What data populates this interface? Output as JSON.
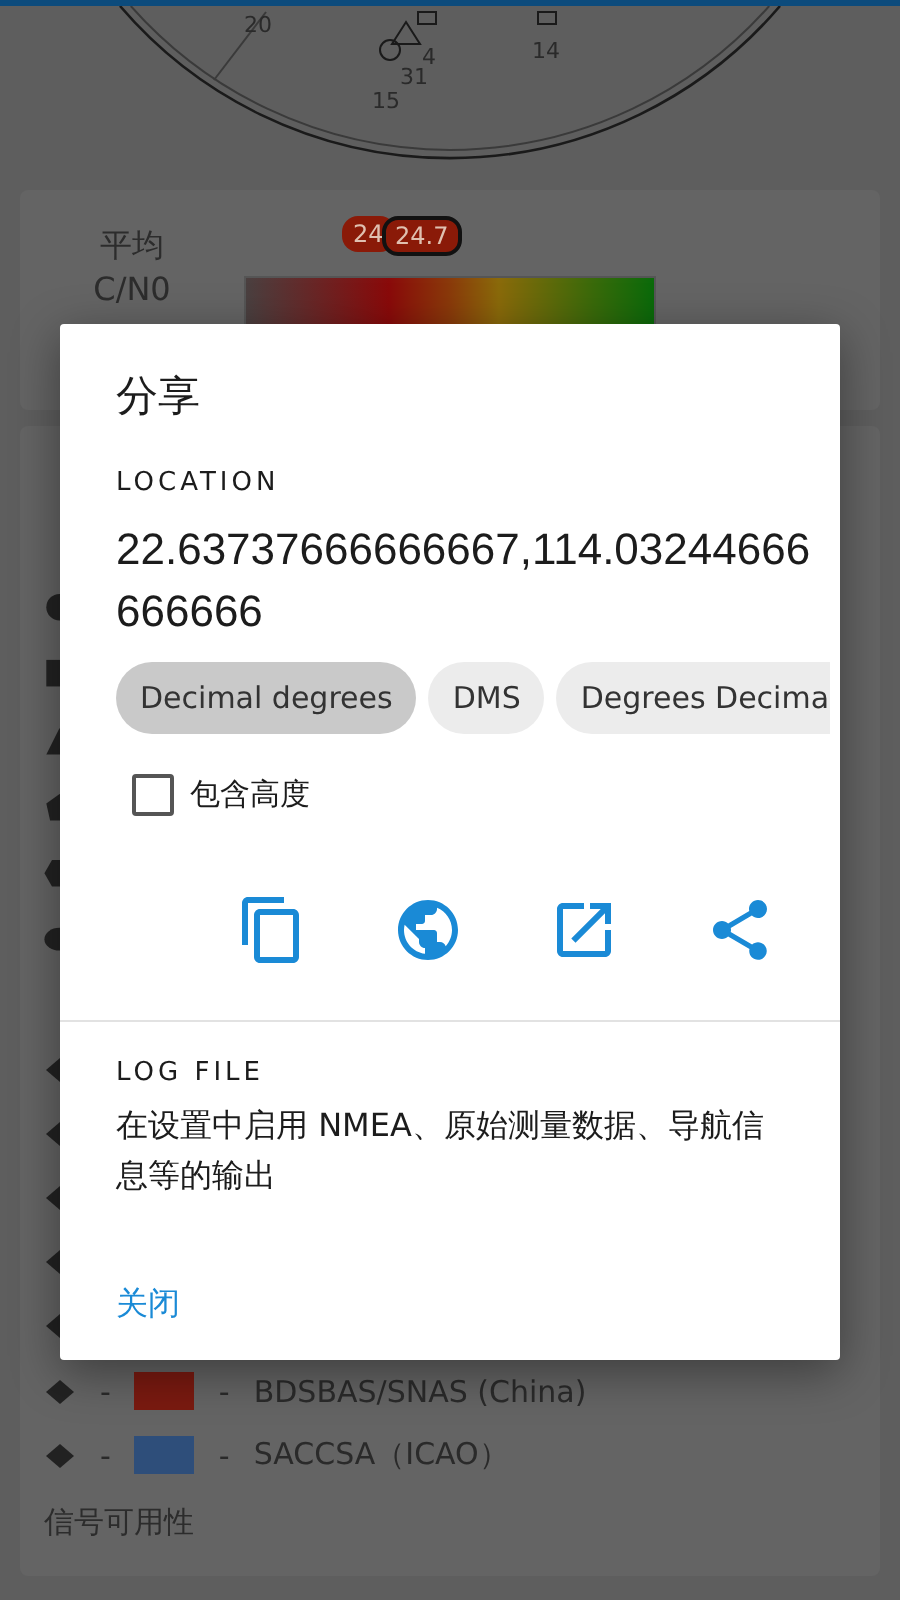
{
  "sky_plot": {
    "labels": [
      "20",
      "4",
      "31",
      "15",
      "14"
    ]
  },
  "cn0_card": {
    "title_lines": [
      "平均",
      "C/N0"
    ],
    "level": 0.42,
    "badges": [
      {
        "text": "24",
        "selected": false
      },
      {
        "text": "24.7",
        "selected": true
      }
    ]
  },
  "list": {
    "rows": [
      {
        "color": "#7a1a10",
        "dashes": [
          "-",
          "-"
        ],
        "name": "BDSBAS/SNAS (China)"
      },
      {
        "color": "#2e4e7a",
        "dashes": [
          "-",
          "-"
        ],
        "name": "SACCSA（ICAO）"
      }
    ],
    "signal_heading": "信号可用性"
  },
  "dialog": {
    "title": "分享",
    "location_label": "LOCATION",
    "location_value": "22.63737666666667,114.03244666666666",
    "formats": [
      {
        "label": "Decimal degrees",
        "selected": true
      },
      {
        "label": "DMS",
        "selected": false
      },
      {
        "label": "Degrees Decima",
        "selected": false
      }
    ],
    "altitude": {
      "label": "包含高度",
      "checked": false
    },
    "log_label": "LOG FILE",
    "log_text": "在设置中启用 NMEA、原始测量数据、导航信息等的输出",
    "close_button": "关闭"
  }
}
